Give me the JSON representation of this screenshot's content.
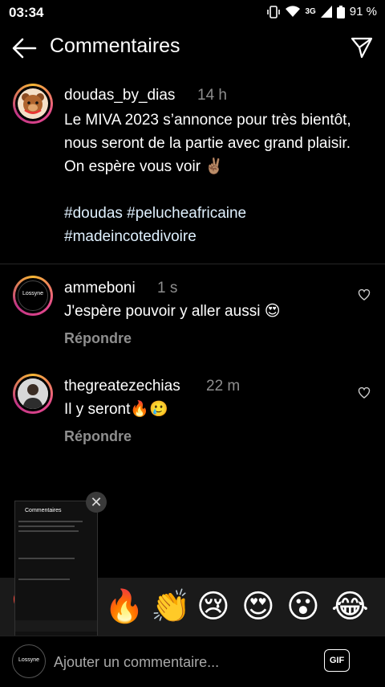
{
  "status_bar": {
    "time": "03:34",
    "network": "3G",
    "battery": "91 %"
  },
  "header": {
    "title": "Commentaires",
    "back_icon": "arrow-left-icon",
    "share_icon": "paper-plane-icon"
  },
  "caption": {
    "username": "doudas_by_dias",
    "time": "14 h",
    "text": "Le MIVA 2023 s’annonce pour très bientôt, nous seront de la partie avec grand plaisir. On espère vous voir ✌🏽",
    "hashtags": "#doudas #pelucheafricaine\n#madeincotedivoire"
  },
  "comments": [
    {
      "username": "ammeboni",
      "time": "1 s",
      "text": "J'espère pouvoir y aller aussi 😍",
      "reply_label": "Répondre",
      "avatar_text": "Lossyne"
    },
    {
      "username": "thegreatezechias",
      "time": "22 m",
      "text": "Il y seront🔥🥲",
      "reply_label": "Répondre"
    }
  ],
  "emoji_bar": [
    "❤️",
    "🙌",
    "🔥",
    "👏",
    "😢",
    "😍",
    "😮",
    "😂"
  ],
  "input": {
    "placeholder": "Ajouter un commentaire...",
    "gif_label": "GIF",
    "avatar_text": "Lossyne"
  },
  "thumbnail": {
    "title": "Commentaires",
    "close_icon": "close-icon"
  },
  "colors": {
    "background": "#000000",
    "secondary_text": "#8e8e8e",
    "story_ring": "#e64a8d"
  }
}
